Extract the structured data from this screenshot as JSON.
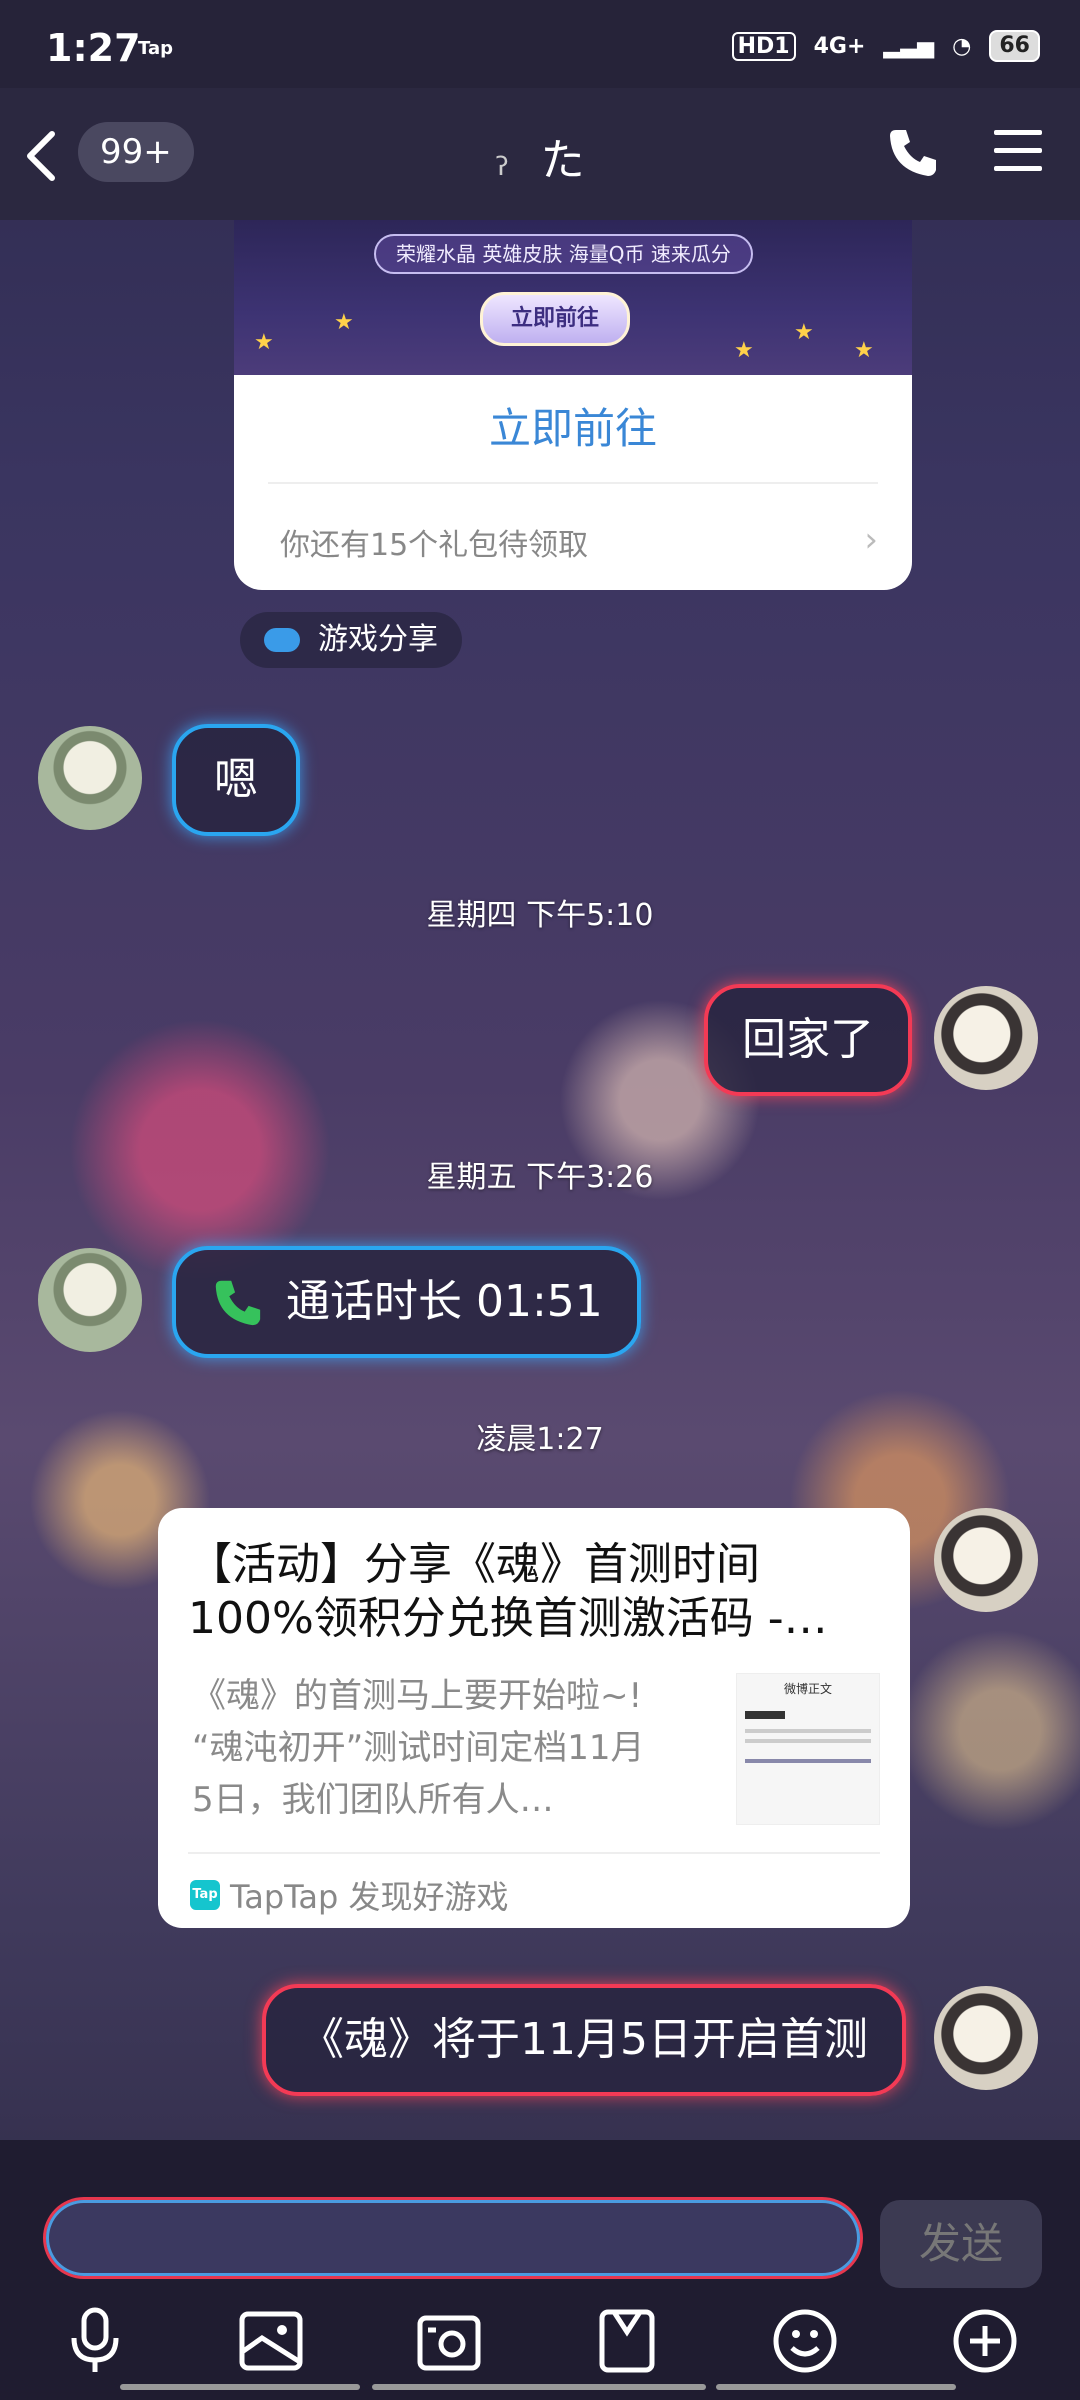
{
  "status_bar": {
    "time": "1:27",
    "app_tag": "Tap",
    "hd": "HD1",
    "network": "4G+",
    "battery": "66"
  },
  "header": {
    "unread_count": "99+",
    "contact_name": "た"
  },
  "game_card": {
    "banner_tags": "荣耀水晶 英雄皮肤 海量Q币 速来瓜分",
    "banner_button": "立即前往",
    "action": "立即前往",
    "footer": "你还有15个礼包待领取"
  },
  "share_tag": "游戏分享",
  "messages": [
    {
      "side": "left",
      "text": "嗯"
    },
    {
      "timestamp": "星期四 下午5:10"
    },
    {
      "side": "right",
      "text": "回家了"
    },
    {
      "timestamp": "星期五 下午3:26"
    },
    {
      "side": "left",
      "text": "通话时长 01:51"
    },
    {
      "timestamp": "凌晨1:27"
    },
    {
      "side": "right",
      "text": "《魂》将于11月5日开启首测"
    }
  ],
  "link_card": {
    "title_line1": "【活动】分享《魂》首测时间",
    "title_line2": "100%领积分兑换首测激活码 -…",
    "desc_line1": "《魂》的首测马上要开始啦~!",
    "desc_line2": "“魂沌初开”测试时间定档11月",
    "desc_line3": "5日，我们团队所有人…",
    "thumb_text": "微博正文",
    "source": "TapTap 发现好游戏"
  },
  "input": {
    "send_label": "发送"
  },
  "colors": {
    "accent_blue": "#2aa6f0",
    "accent_red": "#f33a55",
    "link_blue": "#3a87d6",
    "call_green": "#36c25c"
  },
  "toolbar_icons": [
    "mic-icon",
    "image-icon",
    "camera-icon",
    "file-icon",
    "emoji-icon",
    "plus-icon"
  ]
}
